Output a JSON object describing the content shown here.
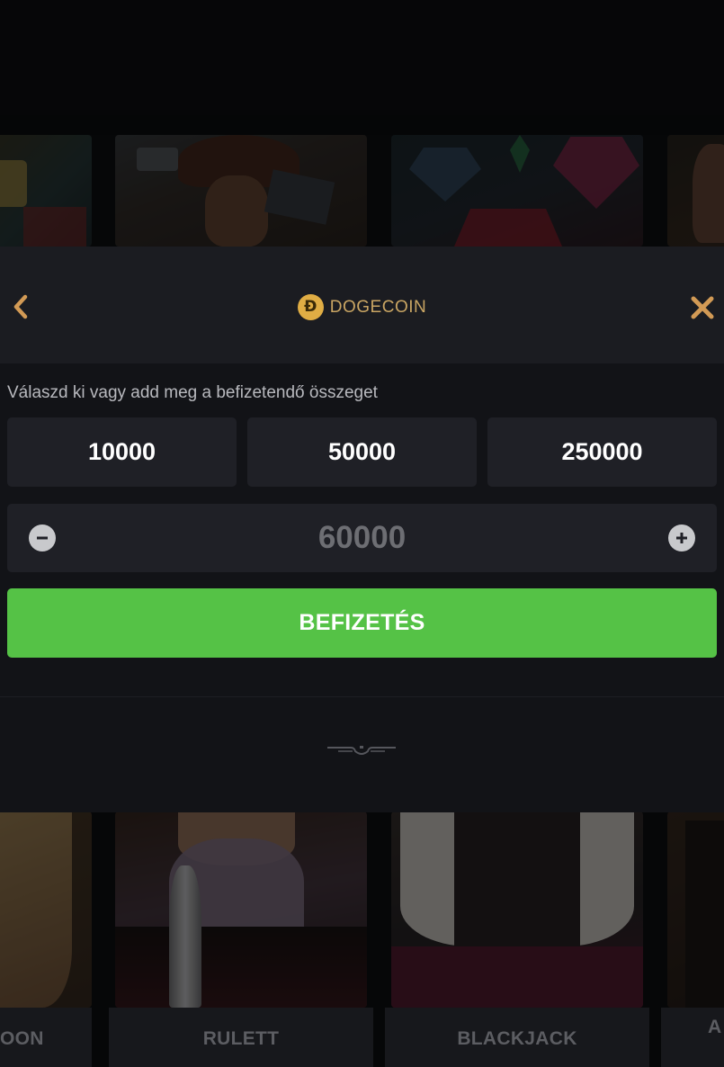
{
  "modal": {
    "currency_name": "DOGECOIN",
    "currency_symbol": "Ð",
    "back_icon": "chevron-left-icon",
    "close_icon": "close-icon",
    "instruction": "Válaszd ki vagy add meg a befizetendő összeget",
    "preset_amounts": [
      "10000",
      "50000",
      "250000"
    ],
    "amount_value": "60000",
    "deposit_label": "BEFIZETÉS"
  },
  "games": {
    "labels": [
      "OON",
      "RULETT",
      "BLACKJACK",
      "A"
    ]
  },
  "colors": {
    "accent_gold": "#e0ad44",
    "currency_text": "#c9a563",
    "nav_icon": "#d29a55",
    "deposit_green": "#55c246",
    "panel": "#1f2026",
    "background": "#121317"
  }
}
